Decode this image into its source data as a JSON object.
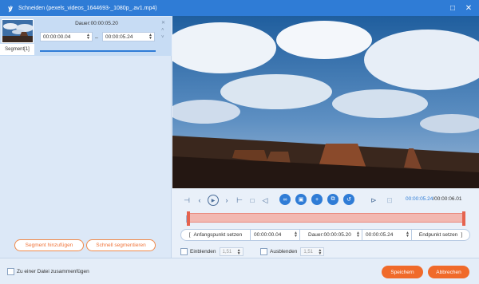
{
  "window": {
    "title": "Schneiden (pexels_videos_1644693-_1080p_.av1.mp4)",
    "minimize_icon": "□",
    "close_icon": "✕"
  },
  "segment": {
    "label": "Segment[1]",
    "duration": "Dauer:00:00:05.20",
    "start": "00:00:00.04",
    "end": "00:00:05.24",
    "dash": "–"
  },
  "left_buttons": {
    "add_segment": "Segment hinzufügen",
    "quick_split": "Schnell segmentieren"
  },
  "playback": {
    "current_time": "00:00:05.24",
    "total_time": "/00:00:06.01"
  },
  "trim": {
    "set_start": "Anfangspunkt setzen",
    "start_value": "00:00:00.04",
    "duration": "Dauer:00:00:05.20",
    "end_value": "00:00:05.24",
    "set_end": "Endpunkt setzen"
  },
  "fade": {
    "fade_in_label": "Einblenden",
    "fade_in_value": "1,51",
    "fade_out_label": "Ausblenden",
    "fade_out_value": "1,51"
  },
  "footer": {
    "merge_label": "Zu einer Datei zusammenfügen",
    "save": "Speichern",
    "cancel": "Abbrechen"
  },
  "colors": {
    "accent": "#2f7cd6",
    "orange": "#f06a2a",
    "timeline_fill": "#f2b8b1"
  }
}
